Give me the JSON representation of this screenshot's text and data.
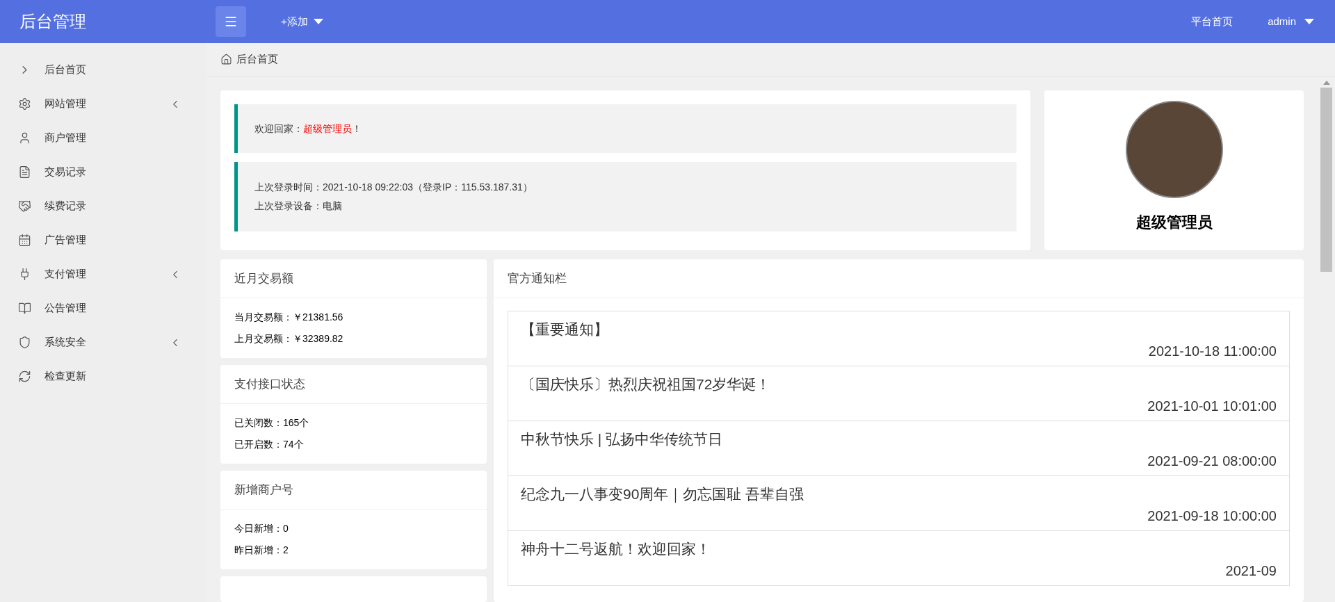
{
  "header": {
    "logo": "后台管理",
    "add_menu": "+添加",
    "links": [
      "平台首页"
    ],
    "user": "admin"
  },
  "sidebar": {
    "items": [
      {
        "label": "后台首页",
        "expandable": false
      },
      {
        "label": "网站管理",
        "expandable": true
      },
      {
        "label": "商户管理",
        "expandable": false
      },
      {
        "label": "交易记录",
        "expandable": false
      },
      {
        "label": "续费记录",
        "expandable": false
      },
      {
        "label": "广告管理",
        "expandable": false
      },
      {
        "label": "支付管理",
        "expandable": true
      },
      {
        "label": "公告管理",
        "expandable": false
      },
      {
        "label": "系统安全",
        "expandable": true
      },
      {
        "label": "检查更新",
        "expandable": false
      }
    ]
  },
  "breadcrumb": "后台首页",
  "welcome": {
    "greeting": "欢迎回家：",
    "role": "超级管理员",
    "suffix": "！",
    "last_login": "上次登录时间：2021-10-18 09:22:03（登录IP：115.53.187.31）",
    "device": "上次登录设备：电脑"
  },
  "profile": {
    "name": "超级管理员"
  },
  "stat_cards": [
    {
      "title": "近月交易额",
      "lines": [
        "当月交易额：￥21381.56",
        "上月交易额：￥32389.82"
      ]
    },
    {
      "title": "支付接口状态",
      "lines": [
        "已关闭数：165个",
        "已开启数：74个"
      ]
    },
    {
      "title": "新增商户号",
      "lines": [
        "今日新增：0",
        "昨日新增：2"
      ]
    }
  ],
  "notices": {
    "title": "官方通知栏",
    "items": [
      {
        "title": "【重要通知】",
        "date": "2021-10-18 11:00:00"
      },
      {
        "title": "〔国庆快乐〕热烈庆祝祖国72岁华诞！",
        "date": "2021-10-01 10:01:00"
      },
      {
        "title": "中秋节快乐 | 弘扬中华传统节日",
        "date": "2021-09-21 08:00:00"
      },
      {
        "title": "纪念九一八事变90周年｜勿忘国耻 吾辈自强",
        "date": "2021-09-18 10:00:00"
      },
      {
        "title": "神舟十二号返航！欢迎回家！",
        "date": "2021-09"
      }
    ]
  }
}
